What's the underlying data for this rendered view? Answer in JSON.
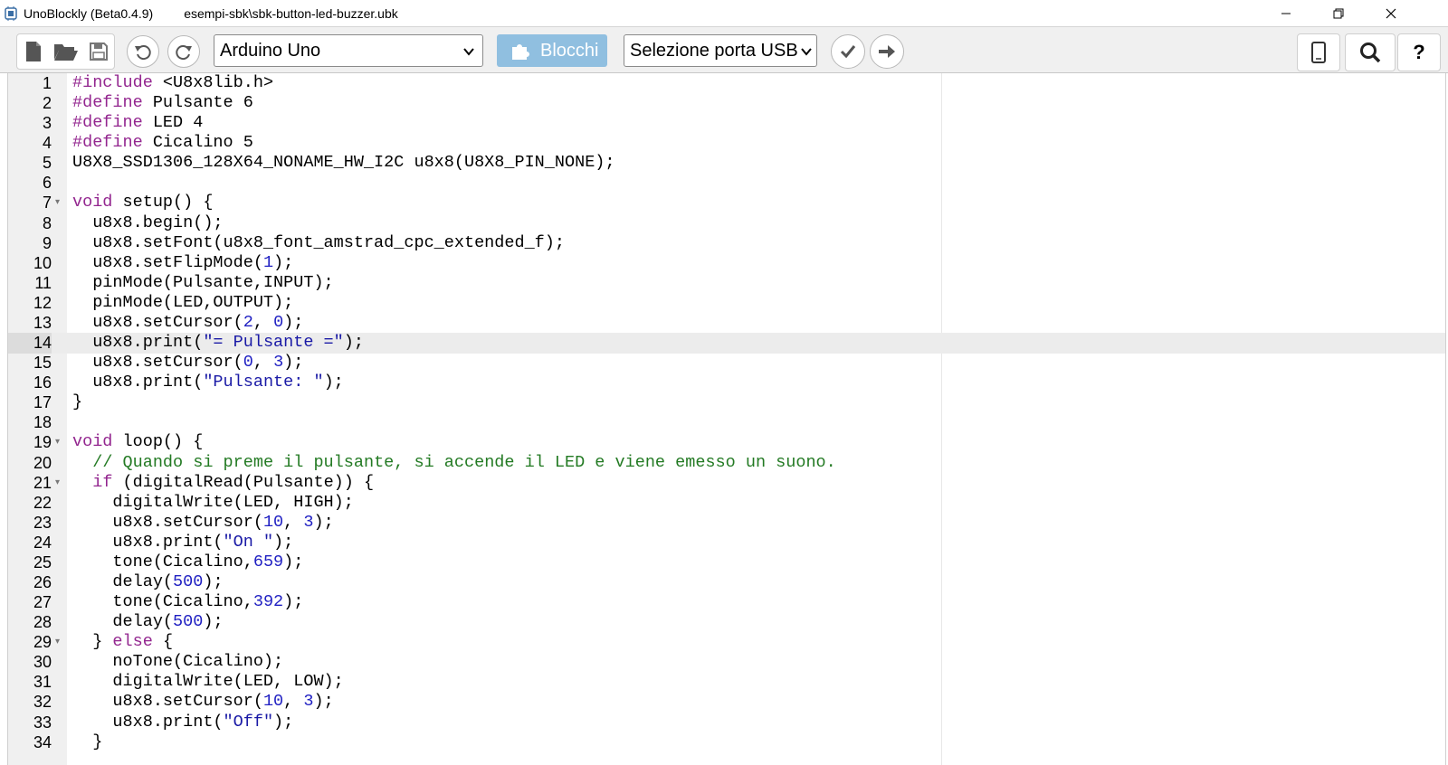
{
  "window": {
    "app_title": "UnoBlockly (Beta0.4.9)",
    "file_path": "esempi-sbk\\sbk-button-led-buzzer.ubk",
    "minimize_glyph": "—",
    "close_glyph": "✕"
  },
  "toolbar": {
    "board_select": "Arduino Uno",
    "blocks_button": "Blocchi",
    "port_select": "Selezione porta USB",
    "help_label": "?",
    "accent_color": "#90bfe0"
  },
  "icons": [
    "new-file-icon",
    "open-folder-icon",
    "save-icon",
    "undo-icon",
    "redo-icon",
    "puzzle-icon",
    "check-icon",
    "arrow-right-icon",
    "tablet-icon",
    "search-icon",
    "help-icon"
  ],
  "editor": {
    "active_line": 14,
    "lines": [
      {
        "n": "1",
        "tokens": [
          [
            "kw",
            "#include"
          ],
          [
            "",
            " <U8x8lib.h>"
          ]
        ]
      },
      {
        "n": "2",
        "tokens": [
          [
            "kw",
            "#define"
          ],
          [
            "",
            " Pulsante 6"
          ]
        ]
      },
      {
        "n": "3",
        "tokens": [
          [
            "kw",
            "#define"
          ],
          [
            "",
            " LED 4"
          ]
        ]
      },
      {
        "n": "4",
        "tokens": [
          [
            "kw",
            "#define"
          ],
          [
            "",
            " Cicalino 5"
          ]
        ]
      },
      {
        "n": "5",
        "tokens": [
          [
            "",
            "U8X8_SSD1306_128X64_NONAME_HW_I2C u8x8(U8X8_PIN_NONE);"
          ]
        ]
      },
      {
        "n": "6",
        "tokens": []
      },
      {
        "n": "7",
        "fold": true,
        "tokens": [
          [
            "kw",
            "void"
          ],
          [
            "",
            " setup() {"
          ]
        ]
      },
      {
        "n": "8",
        "tokens": [
          [
            "",
            "  u8x8.begin();"
          ]
        ]
      },
      {
        "n": "9",
        "tokens": [
          [
            "",
            "  u8x8.setFont(u8x8_font_amstrad_cpc_extended_f);"
          ]
        ]
      },
      {
        "n": "10",
        "tokens": [
          [
            "",
            "  u8x8.setFlipMode("
          ],
          [
            "num",
            "1"
          ],
          [
            "",
            ");"
          ]
        ]
      },
      {
        "n": "11",
        "tokens": [
          [
            "",
            "  pinMode(Pulsante,INPUT);"
          ]
        ]
      },
      {
        "n": "12",
        "tokens": [
          [
            "",
            "  pinMode(LED,OUTPUT);"
          ]
        ]
      },
      {
        "n": "13",
        "tokens": [
          [
            "",
            "  u8x8.setCursor("
          ],
          [
            "num",
            "2"
          ],
          [
            "",
            ", "
          ],
          [
            "num",
            "0"
          ],
          [
            "",
            ");"
          ]
        ]
      },
      {
        "n": "14",
        "tokens": [
          [
            "",
            "  u8x8.print("
          ],
          [
            "str",
            "\"= Pulsante =\""
          ],
          [
            "",
            ");"
          ]
        ]
      },
      {
        "n": "15",
        "tokens": [
          [
            "",
            "  u8x8.setCursor("
          ],
          [
            "num",
            "0"
          ],
          [
            "",
            ", "
          ],
          [
            "num",
            "3"
          ],
          [
            "",
            ");"
          ]
        ]
      },
      {
        "n": "16",
        "tokens": [
          [
            "",
            "  u8x8.print("
          ],
          [
            "str",
            "\"Pulsante: \""
          ],
          [
            "",
            ");"
          ]
        ]
      },
      {
        "n": "17",
        "tokens": [
          [
            "",
            "}"
          ]
        ]
      },
      {
        "n": "18",
        "tokens": []
      },
      {
        "n": "19",
        "fold": true,
        "tokens": [
          [
            "kw",
            "void"
          ],
          [
            "",
            " loop() {"
          ]
        ]
      },
      {
        "n": "20",
        "tokens": [
          [
            "",
            "  "
          ],
          [
            "cmt",
            "// Quando si preme il pulsante, si accende il LED e viene emesso un suono."
          ]
        ]
      },
      {
        "n": "21",
        "fold": true,
        "tokens": [
          [
            "",
            "  "
          ],
          [
            "kw",
            "if"
          ],
          [
            "",
            " (digitalRead(Pulsante)) {"
          ]
        ]
      },
      {
        "n": "22",
        "tokens": [
          [
            "",
            "    digitalWrite(LED, HIGH);"
          ]
        ]
      },
      {
        "n": "23",
        "tokens": [
          [
            "",
            "    u8x8.setCursor("
          ],
          [
            "num",
            "10"
          ],
          [
            "",
            ", "
          ],
          [
            "num",
            "3"
          ],
          [
            "",
            ");"
          ]
        ]
      },
      {
        "n": "24",
        "tokens": [
          [
            "",
            "    u8x8.print("
          ],
          [
            "str",
            "\"On \""
          ],
          [
            "",
            ");"
          ]
        ]
      },
      {
        "n": "25",
        "tokens": [
          [
            "",
            "    tone(Cicalino,"
          ],
          [
            "num",
            "659"
          ],
          [
            "",
            ");"
          ]
        ]
      },
      {
        "n": "26",
        "tokens": [
          [
            "",
            "    delay("
          ],
          [
            "num",
            "500"
          ],
          [
            "",
            ");"
          ]
        ]
      },
      {
        "n": "27",
        "tokens": [
          [
            "",
            "    tone(Cicalino,"
          ],
          [
            "num",
            "392"
          ],
          [
            "",
            ");"
          ]
        ]
      },
      {
        "n": "28",
        "tokens": [
          [
            "",
            "    delay("
          ],
          [
            "num",
            "500"
          ],
          [
            "",
            ");"
          ]
        ]
      },
      {
        "n": "29",
        "fold": true,
        "tokens": [
          [
            "",
            "  } "
          ],
          [
            "kw",
            "else"
          ],
          [
            "",
            " {"
          ]
        ]
      },
      {
        "n": "30",
        "tokens": [
          [
            "",
            "    noTone(Cicalino);"
          ]
        ]
      },
      {
        "n": "31",
        "tokens": [
          [
            "",
            "    digitalWrite(LED, LOW);"
          ]
        ]
      },
      {
        "n": "32",
        "tokens": [
          [
            "",
            "    u8x8.setCursor("
          ],
          [
            "num",
            "10"
          ],
          [
            "",
            ", "
          ],
          [
            "num",
            "3"
          ],
          [
            "",
            ");"
          ]
        ]
      },
      {
        "n": "33",
        "tokens": [
          [
            "",
            "    u8x8.print("
          ],
          [
            "str",
            "\"Off\""
          ],
          [
            "",
            ");"
          ]
        ]
      },
      {
        "n": "34",
        "tokens": [
          [
            "",
            "  }"
          ]
        ]
      }
    ]
  }
}
